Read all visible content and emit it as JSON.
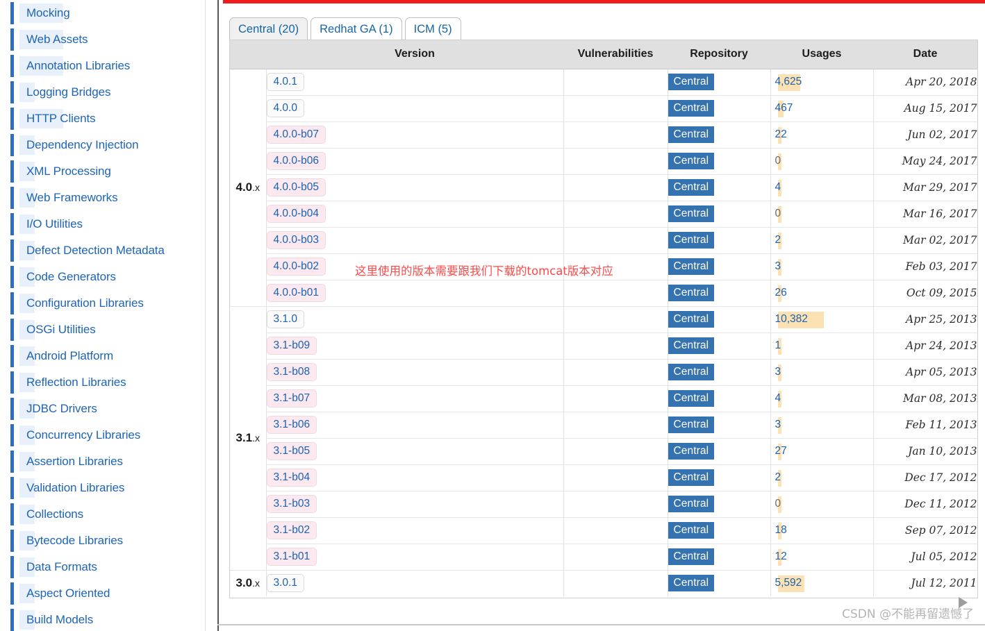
{
  "sidebar": {
    "items": [
      {
        "label": "Mocking",
        "hl": "wide"
      },
      {
        "label": "Web Assets",
        "hl": "wide"
      },
      {
        "label": "Annotation Libraries",
        "hl": "wide"
      },
      {
        "label": "Logging Bridges",
        "hl": "narrow"
      },
      {
        "label": "HTTP Clients",
        "hl": "wide"
      },
      {
        "label": "Dependency Injection",
        "hl": "narrow"
      },
      {
        "label": "XML Processing",
        "hl": "narrow"
      },
      {
        "label": "Web Frameworks",
        "hl": "narrow"
      },
      {
        "label": "I/O Utilities",
        "hl": "narrow"
      },
      {
        "label": "Defect Detection Metadata",
        "hl": "narrow"
      },
      {
        "label": "Code Generators",
        "hl": "narrow"
      },
      {
        "label": "Configuration Libraries",
        "hl": "narrow"
      },
      {
        "label": "OSGi Utilities",
        "hl": "narrow"
      },
      {
        "label": "Android Platform",
        "hl": "narrow"
      },
      {
        "label": "Reflection Libraries",
        "hl": "narrow"
      },
      {
        "label": "JDBC Drivers",
        "hl": "narrow"
      },
      {
        "label": "Concurrency Libraries",
        "hl": "narrow"
      },
      {
        "label": "Assertion Libraries",
        "hl": "narrow"
      },
      {
        "label": "Validation Libraries",
        "hl": "narrow"
      },
      {
        "label": "Collections",
        "hl": "narrow"
      },
      {
        "label": "Bytecode Libraries",
        "hl": "narrow"
      },
      {
        "label": "Data Formats",
        "hl": "narrow"
      },
      {
        "label": "Aspect Oriented",
        "hl": "narrow"
      },
      {
        "label": "Build Models",
        "hl": "narrow"
      }
    ]
  },
  "tabs": [
    {
      "label": "Central (20)",
      "active": true
    },
    {
      "label": "Redhat GA (1)",
      "active": false
    },
    {
      "label": "ICM (5)",
      "active": false
    }
  ],
  "table": {
    "headers": [
      "",
      "Version",
      "Vulnerabilities",
      "Repository",
      "Usages",
      "Date"
    ],
    "rows": [
      {
        "group": "4.0",
        "group_rows": 9,
        "version": "4.0.1",
        "beta": false,
        "vulnerabilities": "",
        "repository": "Central",
        "usages": "4,625",
        "usages_num": 4625,
        "date": "Apr 20, 2018"
      },
      {
        "group": null,
        "version": "4.0.0",
        "beta": false,
        "vulnerabilities": "",
        "repository": "Central",
        "usages": "467",
        "usages_num": 467,
        "date": "Aug 15, 2017"
      },
      {
        "group": null,
        "version": "4.0.0-b07",
        "beta": true,
        "vulnerabilities": "",
        "repository": "Central",
        "usages": "22",
        "usages_num": 22,
        "date": "Jun 02, 2017"
      },
      {
        "group": null,
        "version": "4.0.0-b06",
        "beta": true,
        "vulnerabilities": "",
        "repository": "Central",
        "usages": "0",
        "usages_num": 0,
        "date": "May 24, 2017"
      },
      {
        "group": null,
        "version": "4.0.0-b05",
        "beta": true,
        "vulnerabilities": "",
        "repository": "Central",
        "usages": "4",
        "usages_num": 4,
        "date": "Mar 29, 2017"
      },
      {
        "group": null,
        "version": "4.0.0-b04",
        "beta": true,
        "vulnerabilities": "",
        "repository": "Central",
        "usages": "0",
        "usages_num": 0,
        "date": "Mar 16, 2017"
      },
      {
        "group": null,
        "version": "4.0.0-b03",
        "beta": true,
        "vulnerabilities": "",
        "repository": "Central",
        "usages": "2",
        "usages_num": 2,
        "date": "Mar 02, 2017"
      },
      {
        "group": null,
        "version": "4.0.0-b02",
        "beta": true,
        "vulnerabilities": "",
        "repository": "Central",
        "usages": "3",
        "usages_num": 3,
        "date": "Feb 03, 2017"
      },
      {
        "group": null,
        "version": "4.0.0-b01",
        "beta": true,
        "vulnerabilities": "",
        "repository": "Central",
        "usages": "26",
        "usages_num": 26,
        "date": "Oct 09, 2015"
      },
      {
        "group": "3.1",
        "group_rows": 10,
        "version": "3.1.0",
        "beta": false,
        "vulnerabilities": "",
        "repository": "Central",
        "usages": "10,382",
        "usages_num": 10382,
        "date": "Apr 25, 2013"
      },
      {
        "group": null,
        "version": "3.1-b09",
        "beta": true,
        "vulnerabilities": "",
        "repository": "Central",
        "usages": "1",
        "usages_num": 1,
        "date": "Apr 24, 2013"
      },
      {
        "group": null,
        "version": "3.1-b08",
        "beta": true,
        "vulnerabilities": "",
        "repository": "Central",
        "usages": "3",
        "usages_num": 3,
        "date": "Apr 05, 2013"
      },
      {
        "group": null,
        "version": "3.1-b07",
        "beta": true,
        "vulnerabilities": "",
        "repository": "Central",
        "usages": "4",
        "usages_num": 4,
        "date": "Mar 08, 2013"
      },
      {
        "group": null,
        "version": "3.1-b06",
        "beta": true,
        "vulnerabilities": "",
        "repository": "Central",
        "usages": "3",
        "usages_num": 3,
        "date": "Feb 11, 2013"
      },
      {
        "group": null,
        "version": "3.1-b05",
        "beta": true,
        "vulnerabilities": "",
        "repository": "Central",
        "usages": "27",
        "usages_num": 27,
        "date": "Jan 10, 2013"
      },
      {
        "group": null,
        "version": "3.1-b04",
        "beta": true,
        "vulnerabilities": "",
        "repository": "Central",
        "usages": "2",
        "usages_num": 2,
        "date": "Dec 17, 2012"
      },
      {
        "group": null,
        "version": "3.1-b03",
        "beta": true,
        "vulnerabilities": "",
        "repository": "Central",
        "usages": "0",
        "usages_num": 0,
        "date": "Dec 11, 2012"
      },
      {
        "group": null,
        "version": "3.1-b02",
        "beta": true,
        "vulnerabilities": "",
        "repository": "Central",
        "usages": "18",
        "usages_num": 18,
        "date": "Sep 07, 2012"
      },
      {
        "group": null,
        "version": "3.1-b01",
        "beta": true,
        "vulnerabilities": "",
        "repository": "Central",
        "usages": "12",
        "usages_num": 12,
        "date": "Jul 05, 2012"
      },
      {
        "group": "3.0",
        "group_rows": 1,
        "version": "3.0.1",
        "beta": false,
        "vulnerabilities": "",
        "repository": "Central",
        "usages": "5,592",
        "usages_num": 5592,
        "date": "Jul 12, 2011"
      }
    ]
  },
  "annotation": {
    "text": "这里使用的版本需要跟我们下载的tomcat版本对应",
    "color": "#fb4a4a"
  },
  "scrollbar": {
    "left_arrow": "◀",
    "right_arrow": "▶"
  },
  "watermark": {
    "text": "CSDN @不能再留遗憾了"
  },
  "colors": {
    "accent_link": "#1e64b4",
    "repo_badge": "#3572b0",
    "usage_bar": "#fce2b2",
    "beta_badge": "#fbe9ef",
    "annotation_red": "#fb4a4a",
    "top_rule_red": "#ee1c1c"
  }
}
